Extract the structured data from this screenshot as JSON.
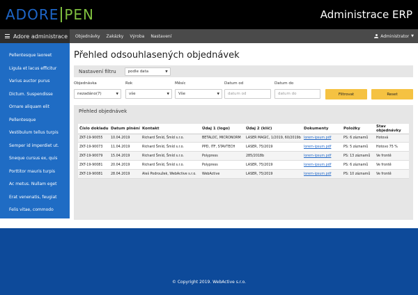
{
  "header": {
    "logo_left": "ADORE",
    "logo_right": "PEN",
    "app_title": "Administrace ERP"
  },
  "navbar": {
    "brand": "Adore administrace",
    "links": [
      "Objednávky",
      "Zakázky",
      "Výroba",
      "Nastavení"
    ],
    "user": "Administrator"
  },
  "sidebar": {
    "items": [
      "Pellentesque laoreet",
      "Ligula et lacus efficitur",
      "Varius auctor purus",
      "Dictum. Suspendisse",
      "Ornare aliquam elit",
      "Pellentesque",
      "Vestibulum tellus turpis",
      "Semper id imperdiet ut.",
      "Sneque cursus ex, quis",
      "Porttitor mauris turpis",
      "Ac metus. Nullam eget",
      "Erat venenatis, feugiat",
      "Felis vitae, commodo"
    ]
  },
  "main": {
    "title": "Přehled odsouhlasených objednávek",
    "filter": {
      "label": "Nastavení filtru",
      "sort_value": "podle data",
      "fields": {
        "objednavka_label": "Objednávka",
        "objednavka_value": "nezadáno(7)",
        "rok_label": "Rok",
        "rok_value": "vše",
        "mesic_label": "Měsíc",
        "mesic_value": "Vše",
        "datum_od_label": "Datum od",
        "datum_od_placeholder": "datum od",
        "datum_do_label": "Datum do",
        "datum_do_placeholder": "datum do"
      },
      "filter_button": "Filtrovat",
      "reset_button": "Reset"
    },
    "orders": {
      "label": "Přehled objednávek",
      "columns": [
        "Číslo dokladu",
        "Datum plnění",
        "Kontakt",
        "Údaj 1 (logo)",
        "Údaj 2 (klíč)",
        "Dokumenty",
        "Položky",
        "Stav objednávky"
      ],
      "rows": [
        [
          "ZKT-19-90055",
          "10.04.2019",
          "Richard Šmíd, Šmíd s.r.o.",
          "BETALOC, MICRONORM",
          "LASER MAGIC, 1/2019, 60/2019b",
          "lorem-ipsum.pdf",
          "PS: 6 záznamů",
          "Hotová"
        ],
        [
          "ZKT-19-90073",
          "11.04.2019",
          "Richard Šmíd, Šmíd s.r.o.",
          "PPD, ITF, STAVTECH",
          "LASER, 75/2019",
          "lorem-ipsum.pdf",
          "PS: 5 záznamů",
          "Hotovo 75 %"
        ],
        [
          "ZKT-19-90079",
          "15.04.2019",
          "Richard Šmíd, Šmíd s.r.o.",
          "Polypress",
          "285/2018b",
          "lorem-ipsum.pdf",
          "PS: 13 záznamů",
          "Ve frontě"
        ],
        [
          "ZKT-19-90081",
          "20.04.2019",
          "Richard Šmíd, Šmíd s.r.o.",
          "Polypress",
          "LASER, 75/2019",
          "lorem-ipsum.pdf",
          "PS: 6 záznamů",
          "Ve frontě"
        ],
        [
          "ZKT-19-90081",
          "28.04.2019",
          "Aleš Podroužek, WebActive s.r.o.",
          "WebActive",
          "LASER, 75/2019",
          "lorem-ipsum.pdf",
          "PS: 10 záznamů",
          "Ve frontě"
        ]
      ],
      "status_colors": [
        "#2a9a2a",
        "#e87c1e",
        "#d42a2a",
        "#d42a2a",
        "#d42a2a"
      ]
    }
  },
  "footer": {
    "copyright": "© Copyright 2019. WebActive s.r.o."
  }
}
